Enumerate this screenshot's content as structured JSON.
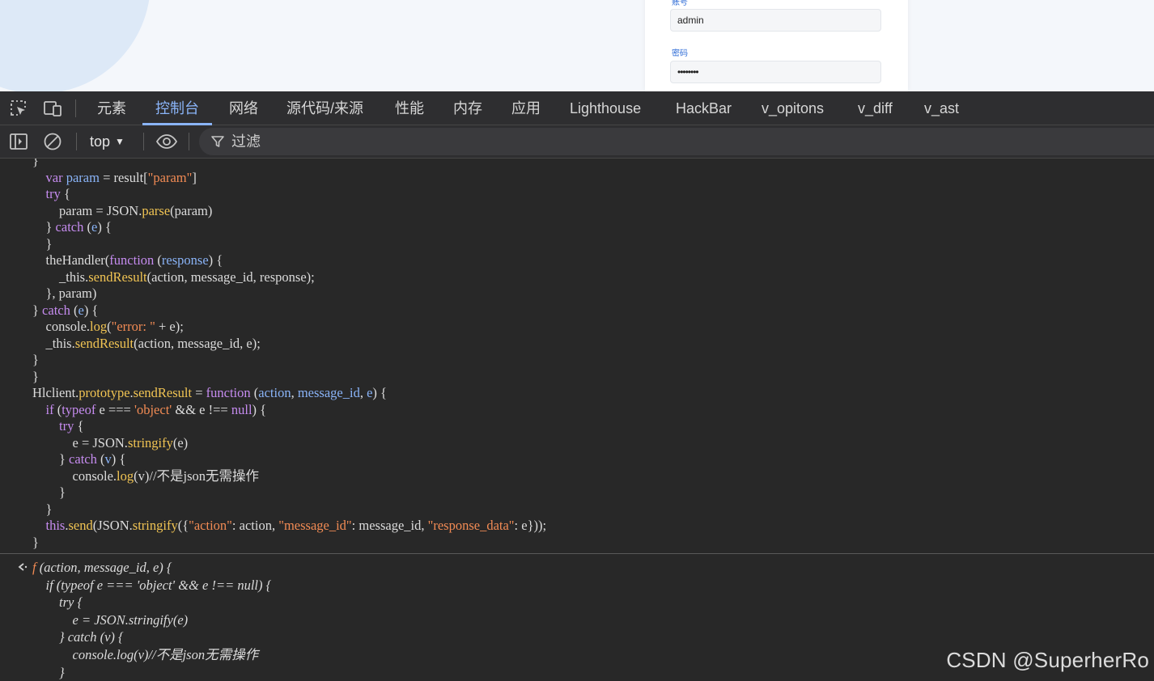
{
  "page": {
    "username_label": "账号",
    "username_value": "admin",
    "password_label": "密码",
    "password_value": "••••••••"
  },
  "devtools": {
    "tabs": [
      {
        "label": "元素",
        "active": false
      },
      {
        "label": "控制台",
        "active": true
      },
      {
        "label": "网络",
        "active": false
      },
      {
        "label": "源代码/来源",
        "active": false
      },
      {
        "label": "性能",
        "active": false
      },
      {
        "label": "内存",
        "active": false
      },
      {
        "label": "应用",
        "active": false
      },
      {
        "label": "Lighthouse",
        "active": false
      },
      {
        "label": "HackBar",
        "active": false
      },
      {
        "label": "v_opitons",
        "active": false
      },
      {
        "label": "v_diff",
        "active": false
      },
      {
        "label": "v_ast",
        "active": false
      }
    ],
    "accent_color": "#8ab4f8"
  },
  "console_toolbar": {
    "context": "top",
    "filter_placeholder": "过滤"
  },
  "console": {
    "code_lines": [
      [
        [
          "}",
          ""
        ]
      ],
      [
        [
          "    ",
          ""
        ],
        [
          "var",
          "k"
        ],
        [
          " ",
          ""
        ],
        [
          "param",
          "v"
        ],
        [
          " = result[",
          ""
        ],
        [
          "\"param\"",
          "s"
        ],
        [
          "]",
          ""
        ]
      ],
      [
        [
          "    ",
          ""
        ],
        [
          "try",
          "k"
        ],
        [
          " {",
          ""
        ]
      ],
      [
        [
          "        param = JSON.",
          ""
        ],
        [
          "parse",
          "f"
        ],
        [
          "(param)",
          ""
        ]
      ],
      [
        [
          "    } ",
          ""
        ],
        [
          "catch",
          "k"
        ],
        [
          " (",
          ""
        ],
        [
          "e",
          "v"
        ],
        [
          ") {",
          ""
        ]
      ],
      [
        [
          "    }",
          ""
        ]
      ],
      [
        [
          "    theHandler(",
          ""
        ],
        [
          "function",
          "k"
        ],
        [
          " (",
          ""
        ],
        [
          "response",
          "v"
        ],
        [
          ") {",
          ""
        ]
      ],
      [
        [
          "        _this.",
          ""
        ],
        [
          "sendResult",
          "f"
        ],
        [
          "(action, message_id, response);",
          ""
        ]
      ],
      [
        [
          "    }, param)",
          ""
        ]
      ],
      [
        [
          "} ",
          ""
        ],
        [
          "catch",
          "k"
        ],
        [
          " (",
          ""
        ],
        [
          "e",
          "v"
        ],
        [
          ") {",
          ""
        ]
      ],
      [
        [
          "    console.",
          ""
        ],
        [
          "log",
          "f"
        ],
        [
          "(",
          ""
        ],
        [
          "\"error: \"",
          "s"
        ],
        [
          " + e);",
          ""
        ]
      ],
      [
        [
          "    _this.",
          ""
        ],
        [
          "sendResult",
          "f"
        ],
        [
          "(action, message_id, e);",
          ""
        ]
      ],
      [
        [
          "}",
          ""
        ]
      ],
      [
        [
          "}",
          ""
        ]
      ],
      [
        [
          "Hlclient.",
          ""
        ],
        [
          "prototype",
          "f"
        ],
        [
          ".",
          ""
        ],
        [
          "sendResult",
          "f"
        ],
        [
          " = ",
          ""
        ],
        [
          "function",
          "k"
        ],
        [
          " (",
          ""
        ],
        [
          "action",
          "v"
        ],
        [
          ", ",
          ""
        ],
        [
          "message_id",
          "v"
        ],
        [
          ", ",
          ""
        ],
        [
          "e",
          "v"
        ],
        [
          ") {",
          ""
        ]
      ],
      [
        [
          "    ",
          ""
        ],
        [
          "if",
          "k"
        ],
        [
          " (",
          ""
        ],
        [
          "typeof",
          "k"
        ],
        [
          " e === ",
          ""
        ],
        [
          "'object'",
          "s"
        ],
        [
          " && e !== ",
          ""
        ],
        [
          "null",
          "k"
        ],
        [
          ") {",
          ""
        ]
      ],
      [
        [
          "        ",
          ""
        ],
        [
          "try",
          "k"
        ],
        [
          " {",
          ""
        ]
      ],
      [
        [
          "            e = JSON.",
          ""
        ],
        [
          "stringify",
          "f"
        ],
        [
          "(e)",
          ""
        ]
      ],
      [
        [
          "        } ",
          ""
        ],
        [
          "catch",
          "k"
        ],
        [
          " (",
          ""
        ],
        [
          "v",
          "v"
        ],
        [
          ") {",
          ""
        ]
      ],
      [
        [
          "            console.",
          ""
        ],
        [
          "log",
          "f"
        ],
        [
          "(v)//不是json无需操作",
          ""
        ]
      ],
      [
        [
          "        }",
          ""
        ]
      ],
      [
        [
          "    }",
          ""
        ]
      ],
      [
        [
          "    ",
          ""
        ],
        [
          "this",
          "k"
        ],
        [
          ".",
          ""
        ],
        [
          "send",
          "f"
        ],
        [
          "(JSON.",
          ""
        ],
        [
          "stringify",
          "f"
        ],
        [
          "({",
          ""
        ],
        [
          "\"action\"",
          "s"
        ],
        [
          ": action, ",
          ""
        ],
        [
          "\"message_id\"",
          "s"
        ],
        [
          ": message_id, ",
          ""
        ],
        [
          "\"response_data\"",
          "s"
        ],
        [
          ": e}));",
          ""
        ]
      ],
      [
        [
          "}",
          ""
        ]
      ]
    ],
    "result_lines": [
      [
        [
          "f",
          "fi"
        ],
        [
          " (action, message_id, e) {",
          ""
        ]
      ],
      [
        [
          "    if (typeof e === 'object' && e !== null) {",
          ""
        ]
      ],
      [
        [
          "        try {",
          ""
        ]
      ],
      [
        [
          "            e = JSON.stringify(e)",
          ""
        ]
      ],
      [
        [
          "        } catch (v) {",
          ""
        ]
      ],
      [
        [
          "            console.log(v)//不是json无需操作",
          ""
        ]
      ],
      [
        [
          "        }",
          ""
        ]
      ]
    ]
  },
  "watermark": "CSDN @SuperherRo"
}
